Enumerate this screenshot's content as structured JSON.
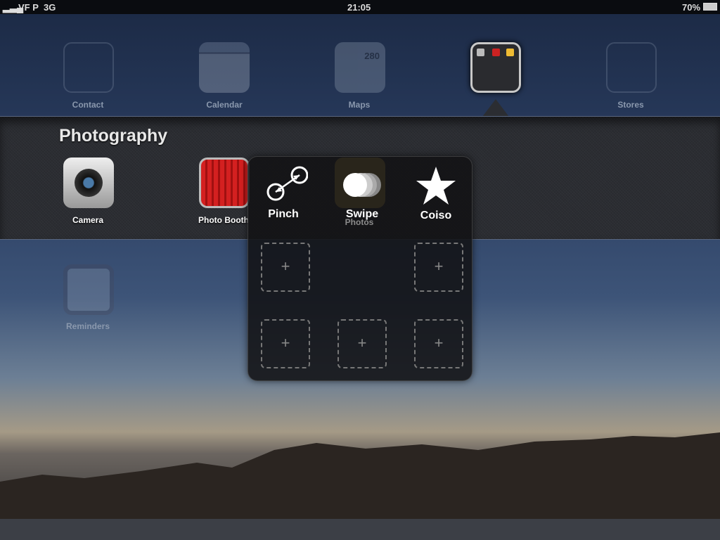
{
  "status_bar": {
    "carrier": "VF P",
    "network": "3G",
    "time": "21:05",
    "battery": "70%"
  },
  "dock_row": [
    {
      "label": "Contact"
    },
    {
      "label": "Calendar"
    },
    {
      "label": "Maps",
      "badge": "280"
    },
    {
      "label": ""
    },
    {
      "label": "Stores"
    }
  ],
  "folder": {
    "title": "Photography",
    "apps": [
      {
        "label": "Camera"
      },
      {
        "label": "Photo Booth"
      },
      {
        "label": "Photos"
      }
    ]
  },
  "home_below": [
    {
      "label": "Reminders"
    }
  ],
  "assistive_touch": {
    "items": [
      {
        "label": "Pinch",
        "icon": "pinch-icon"
      },
      {
        "label": "Swipe",
        "icon": "swipe-icon"
      },
      {
        "label": "Coiso",
        "icon": "star-icon"
      }
    ],
    "empty_slot_symbol": "+"
  }
}
